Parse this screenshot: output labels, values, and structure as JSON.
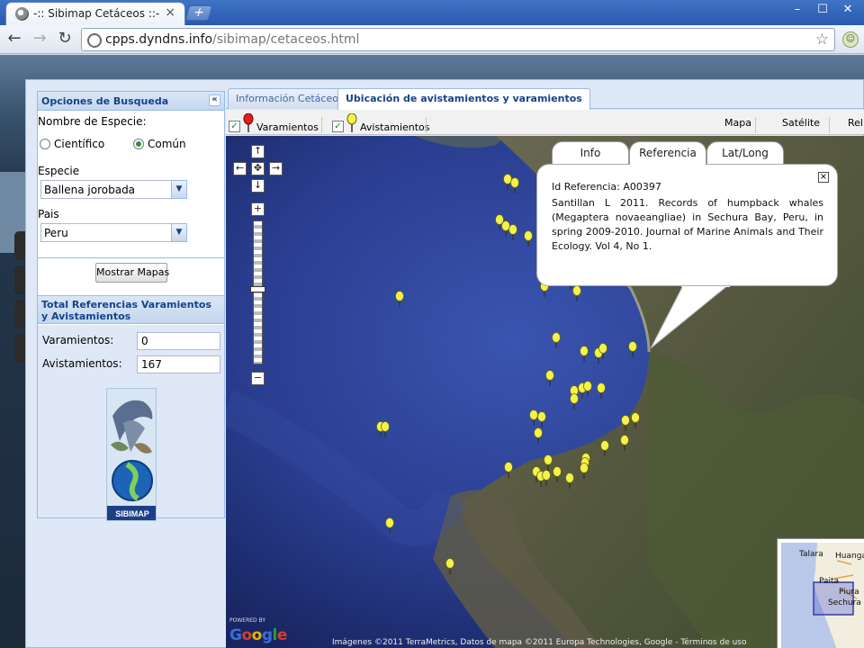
{
  "browser": {
    "tab_title": "-:: Sibimap Cetáceos ::-",
    "tab_close": "×",
    "new_tab": "+",
    "url_host": "cpps.dyndns.info",
    "url_path": "/sibimap/cetaceos.html",
    "back": "←",
    "forward": "→",
    "reload": "↻",
    "star": "☆",
    "minimize": "–",
    "maximize": "☐",
    "close": "✕"
  },
  "search_panel": {
    "title": "Opciones de Busqueda",
    "collapse": "«",
    "species_name_label": "Nombre de Especie:",
    "radio_scientific": "Científico",
    "radio_common": "Común",
    "selected_radio": "Común",
    "species_label": "Especie",
    "species_value": "Ballena jorobada",
    "country_label": "Pais",
    "country_value": "Peru",
    "combo_arrow": "▼",
    "show_maps_button": "Mostrar Mapas"
  },
  "totals_panel": {
    "title": "Total Referencias Varamientos y Avistamientos",
    "strandings_label": "Varamientos:",
    "strandings_value": "0",
    "sightings_label": "Avistamientos:",
    "sightings_value": "167",
    "logo_text": "SIBIMAP"
  },
  "tabs": [
    {
      "label": "Información Cetáceo",
      "active": false
    },
    {
      "label": "Ubicación de avistamientos y varamientos",
      "active": true
    }
  ],
  "map_toolbar": {
    "check_mark": "✓",
    "layer_strandings": "Varamientos",
    "layer_sightings": "Avistamientos",
    "map_types": [
      "Mapa",
      "Satélite",
      "Relie"
    ]
  },
  "map_controls": {
    "pan_up": "↑",
    "pan_left": "←",
    "pan_center": "✥",
    "pan_right": "→",
    "pan_down": "↓",
    "zoom_in": "+",
    "zoom_out": "−"
  },
  "infowindow": {
    "tabs": [
      "Info",
      "Referencia",
      "Lat/Long"
    ],
    "active_tab": "Referencia",
    "close": "×",
    "id_line": "Id Referencia: A00397",
    "reference": "Santillan L 2011. Records of humpback whales (Megaptera novaeangliae) in Sechura Bay, Peru, in spring 2009-2010. Journal of Marine Animals and Their Ecology. Vol 4, No 1."
  },
  "map_footer": {
    "powered_by": "POWERED BY",
    "google": "Google",
    "copyright": "Imágenes ©2011 TerraMetrics, Datos de mapa ©2011 Europa Technologies, Google - Términos de uso"
  },
  "overview_map": {
    "labels": [
      "Talara",
      "Huanga",
      "Paita",
      "Piura",
      "Sechura"
    ]
  },
  "colors": {
    "panel_header": "#15428b",
    "sighting_marker": "#f4f14a",
    "stranding_marker": "#e02020",
    "sea": "#2a3d8f"
  }
}
